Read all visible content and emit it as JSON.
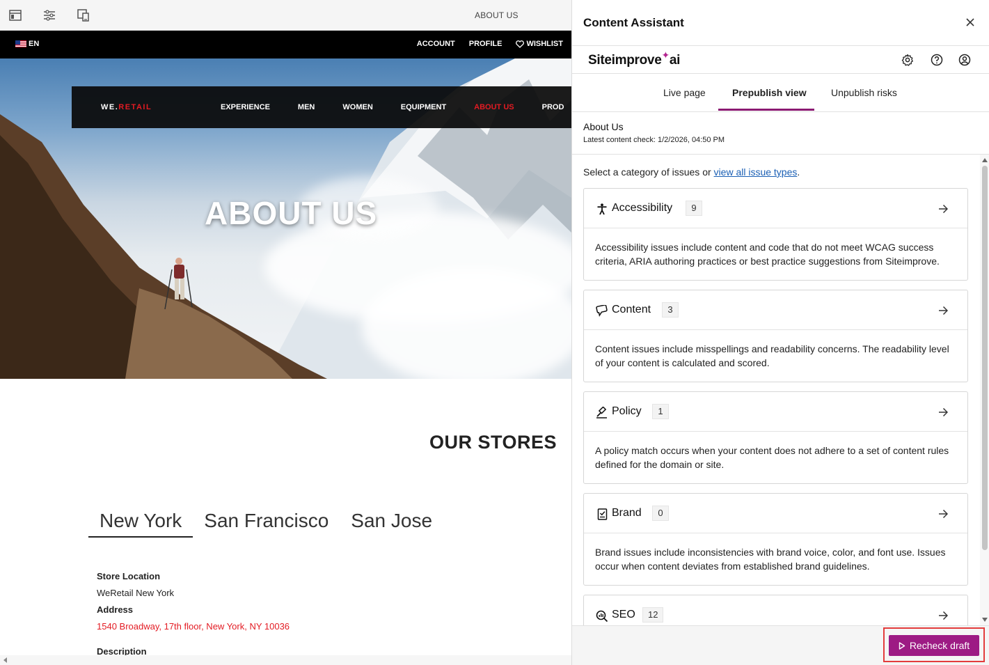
{
  "editor": {
    "page_name": "ABOUT US",
    "topbar": {
      "language": "EN",
      "account": "ACCOUNT",
      "profile": "PROFILE",
      "wishlist": "WISHLIST"
    },
    "nav": {
      "brand_prefix": "WE.",
      "brand_suffix": "RETAIL",
      "items": [
        "EXPERIENCE",
        "MEN",
        "WOMEN",
        "EQUIPMENT",
        "ABOUT US",
        "PROD"
      ]
    },
    "hero_title": "ABOUT US",
    "stores_title": "OUR STORES",
    "store_tabs": [
      "New York",
      "San Francisco",
      "San Jose"
    ],
    "store": {
      "location_label": "Store Location",
      "location_value": "WeRetail New York",
      "address_label": "Address",
      "address_value": "1540 Broadway, 17th floor, New York, NY 10036",
      "description_label": "Description"
    }
  },
  "panel": {
    "title": "Content Assistant",
    "logo_text": "Siteimprove",
    "logo_ai": "ai",
    "tabs": [
      "Live page",
      "Prepublish view",
      "Unpublish risks"
    ],
    "active_tab": "Prepublish view",
    "page_title": "About Us",
    "latest_check": "Latest content check: 1/2/2026, 04:50 PM",
    "intro_text": "Select a category of issues or ",
    "intro_link": "view all issue types",
    "intro_end": ".",
    "categories": [
      {
        "name": "Accessibility",
        "count": "9",
        "icon": "accessibility-icon",
        "description": "Accessibility issues include content and code that do not meet WCAG success criteria, ARIA authoring practices or best practice suggestions from Siteimprove."
      },
      {
        "name": "Content",
        "count": "3",
        "icon": "content-icon",
        "description": "Content issues include misspellings and readability concerns. The readability level of your content is calculated and scored."
      },
      {
        "name": "Policy",
        "count": "1",
        "icon": "policy-icon",
        "description": "A policy match occurs when your content does not adhere to a set of content rules defined for the domain or site."
      },
      {
        "name": "Brand",
        "count": "0",
        "icon": "brand-icon",
        "description": "Brand issues include inconsistencies with brand voice, color, and font use. Issues occur when content deviates from established brand guidelines."
      },
      {
        "name": "SEO",
        "count": "12",
        "icon": "seo-icon",
        "description": ""
      }
    ],
    "recheck_label": "Recheck draft"
  },
  "colors": {
    "accent": "#9d1b84",
    "tab_underline": "#8b1a72",
    "highlight": "#e33c3c",
    "brand_red": "#e31b23",
    "link": "#1a5fb4"
  }
}
